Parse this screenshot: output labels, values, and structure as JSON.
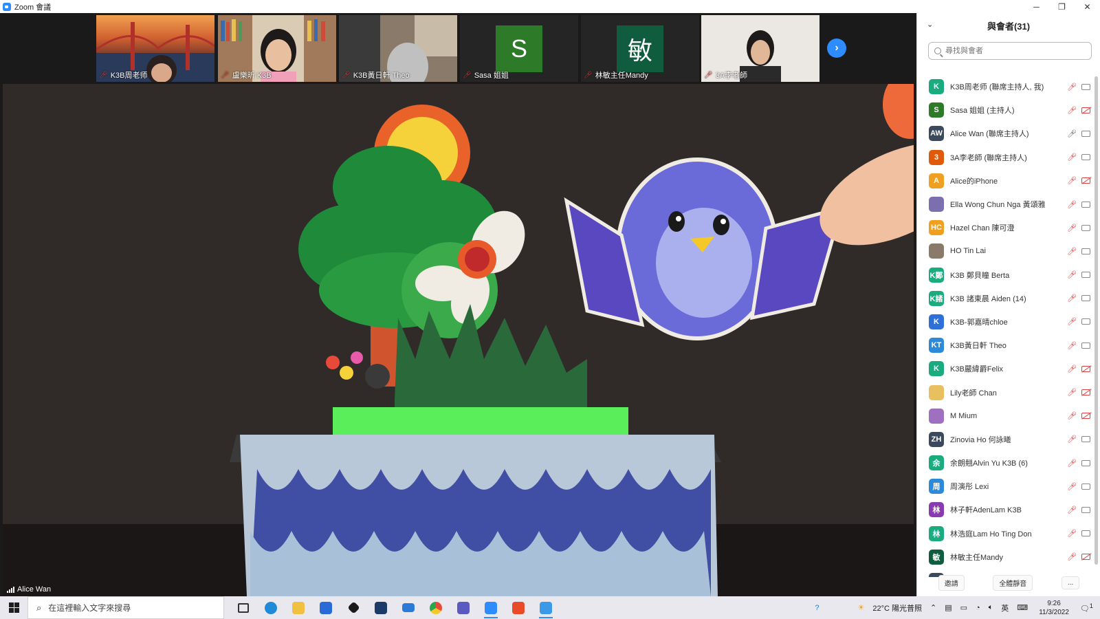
{
  "window": {
    "title": "Zoom 會議",
    "minimize": "─",
    "restore": "❐",
    "close": "✕"
  },
  "thumbnails": [
    {
      "name": "K3B周老师",
      "bg": "golden-gate"
    },
    {
      "name": "盧樂昕 K3B",
      "bg": "bookshelf"
    },
    {
      "name": "K3B黃日軒 Theo",
      "bg": "room"
    },
    {
      "name": "Sasa 姐姐",
      "initial": "S",
      "color": "#2d7a28"
    },
    {
      "name": "林敏主任Mandy",
      "initial": "敏",
      "color": "#0f5c3f"
    },
    {
      "name": "3A李老師",
      "bg": "wall"
    }
  ],
  "next_page": "›",
  "active_speaker": "Alice Wan",
  "panel": {
    "title": "與會者(31)",
    "collapse": "⌄",
    "search_placeholder": "尋找與會者",
    "participants": [
      {
        "name": "K3B周老师 (聯席主持人, 我)",
        "initial": "K",
        "color": "#1aab7f",
        "mic": "muted",
        "cam": "on"
      },
      {
        "name": "Sasa 姐姐 (主持人)",
        "initial": "S",
        "color": "#2d7a28",
        "mic": "muted",
        "cam": "off"
      },
      {
        "name": "Alice Wan (聯席主持人)",
        "initial": "AW",
        "color": "#3a4a5c",
        "mic": "on",
        "cam": "on"
      },
      {
        "name": "3A李老師 (聯席主持人)",
        "initial": "3",
        "color": "#e05a0c",
        "mic": "muted",
        "cam": "on"
      },
      {
        "name": "Alice的iPhone",
        "initial": "A",
        "color": "#f0a020",
        "mic": "muted",
        "cam": "off"
      },
      {
        "name": "Ella Wong Chun Nga 黃頌雅",
        "initial": "",
        "color": "#7b6fb0",
        "mic": "muted",
        "cam": "on"
      },
      {
        "name": "Hazel Chan 陳可澄",
        "initial": "HC",
        "color": "#f0a020",
        "mic": "muted",
        "cam": "on"
      },
      {
        "name": "HO Tin Lai",
        "initial": "",
        "color": "#8a7a6a",
        "mic": "muted",
        "cam": "on"
      },
      {
        "name": "K3B 鄭貝瞳 Berta",
        "initial": "K鄭",
        "color": "#1aab7f",
        "mic": "muted",
        "cam": "on"
      },
      {
        "name": "K3B 諸東晨 Aiden (14)",
        "initial": "K諸",
        "color": "#1aab7f",
        "mic": "muted",
        "cam": "on"
      },
      {
        "name": "K3B-郭嘉晴chloe",
        "initial": "K",
        "color": "#2e6fd8",
        "mic": "muted",
        "cam": "on"
      },
      {
        "name": "K3B黃日軒 Theo",
        "initial": "KT",
        "color": "#2e8ad8",
        "mic": "muted",
        "cam": "on"
      },
      {
        "name": "K3B嚴緯爵Felix",
        "initial": "K",
        "color": "#1aab7f",
        "mic": "muted",
        "cam": "off"
      },
      {
        "name": "Lily老師 Chan",
        "initial": "",
        "color": "#e8c060",
        "mic": "muted",
        "cam": "off"
      },
      {
        "name": "M Mium",
        "initial": "",
        "color": "#a070c0",
        "mic": "muted",
        "cam": "off"
      },
      {
        "name": "Zinovia Ho 何詠曦",
        "initial": "ZH",
        "color": "#3a4a5c",
        "mic": "muted",
        "cam": "on"
      },
      {
        "name": "余朗翹Alvin Yu K3B (6)",
        "initial": "余",
        "color": "#1aab7f",
        "mic": "muted",
        "cam": "on"
      },
      {
        "name": "周演彤 Lexi",
        "initial": "周",
        "color": "#2e8ad8",
        "mic": "muted",
        "cam": "on"
      },
      {
        "name": "林子軒AdenLam K3B",
        "initial": "林",
        "color": "#8a3ab0",
        "mic": "muted",
        "cam": "on"
      },
      {
        "name": "林浩庭Lam Ho Ting Don",
        "initial": "林",
        "color": "#1aab7f",
        "mic": "muted",
        "cam": "on"
      },
      {
        "name": "林敏主任Mandy",
        "initial": "敏",
        "color": "#0f5c3f",
        "mic": "muted",
        "cam": "off"
      },
      {
        "name": "",
        "initial": "",
        "color": "#3a4a5c",
        "mic": "muted",
        "cam": "on"
      }
    ],
    "invite": "邀請",
    "mute_all": "全體靜音",
    "more": "..."
  },
  "taskbar": {
    "search_placeholder": "在這裡輸入文字來搜尋",
    "weather": "22°C 陽光普照",
    "ime": "英",
    "time": "9:26",
    "date": "11/3/2022",
    "notif": "1"
  }
}
